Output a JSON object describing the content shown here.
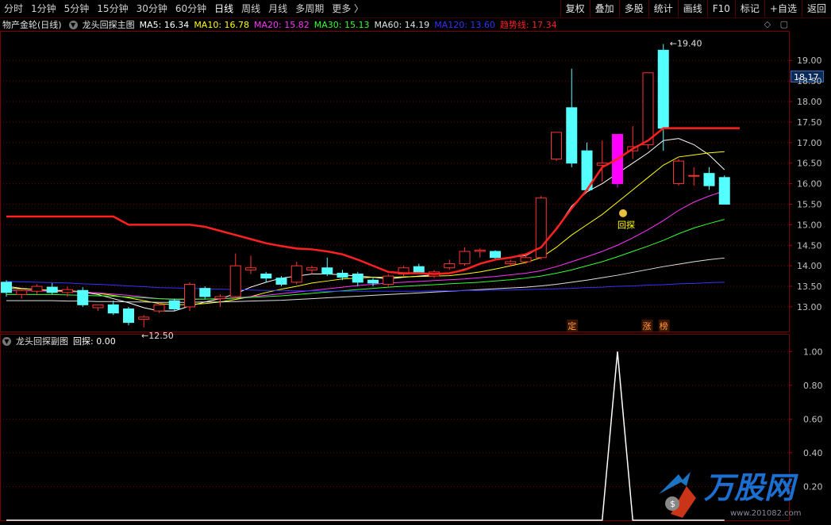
{
  "toolbar": {
    "periods": [
      {
        "label": "分时",
        "active": false
      },
      {
        "label": "1分钟",
        "active": false
      },
      {
        "label": "5分钟",
        "active": false
      },
      {
        "label": "15分钟",
        "active": false
      },
      {
        "label": "30分钟",
        "active": false
      },
      {
        "label": "60分钟",
        "active": false
      },
      {
        "label": "日线",
        "active": true
      },
      {
        "label": "周线",
        "active": false
      },
      {
        "label": "月线",
        "active": false
      },
      {
        "label": "多周期",
        "active": false
      },
      {
        "label": "更多 〉",
        "active": false
      }
    ],
    "buttons": [
      "复权",
      "叠加",
      "多股",
      "统计",
      "画线",
      "F10",
      "标记",
      "+自选",
      "返回"
    ]
  },
  "main_chart": {
    "stock_name": "物产金轮(日线)",
    "indicator_name": "龙头回探主图",
    "ma_labels": [
      {
        "text": "MA5: 16.34",
        "color": "#ffffff"
      },
      {
        "text": "MA10: 16.78",
        "color": "#ffff00"
      },
      {
        "text": "MA20: 15.82",
        "color": "#ff33ff"
      },
      {
        "text": "MA30: 15.13",
        "color": "#33ff33"
      },
      {
        "text": "MA60: 14.19",
        "color": "#e0e0e0"
      },
      {
        "text": "MA120: 13.60",
        "color": "#3333ff"
      },
      {
        "text": "趋势线: 17.34",
        "color": "#ff2020"
      }
    ],
    "price_axis_ticks": [
      "19.00",
      "18.50",
      "18.00",
      "17.50",
      "17.00",
      "16.50",
      "16.00",
      "15.50",
      "15.00",
      "14.50",
      "14.00",
      "13.50",
      "13.00"
    ],
    "current_price": "18.17",
    "high_annotation": "19.40",
    "low_annotation": "12.50",
    "signal_label": "回探",
    "signal_icon": "money-bag-icon",
    "event_tags": [
      "定",
      "涨",
      "榜"
    ]
  },
  "sub_chart": {
    "indicator_name": "龙头回探副图",
    "value_label": "回探: 0.00",
    "axis_ticks": [
      "1.00",
      "0.80",
      "0.60",
      "0.40",
      "0.20"
    ]
  },
  "watermark": {
    "brand": "万股网",
    "url": "www.201082.com"
  },
  "colors": {
    "up_candle": "#ff3232",
    "down_candle": "#54ffff",
    "limit_up_candle": "#ff00ff",
    "trend_line": "#ff2020",
    "grid": "#7a0000"
  },
  "chart_data": {
    "type": "candlestick",
    "price_range": [
      12.4,
      19.7
    ],
    "candles": [
      {
        "o": 13.6,
        "h": 13.65,
        "l": 13.25,
        "c": 13.35
      },
      {
        "o": 13.3,
        "h": 13.45,
        "l": 13.2,
        "c": 13.4
      },
      {
        "o": 13.38,
        "h": 13.55,
        "l": 13.3,
        "c": 13.5
      },
      {
        "o": 13.48,
        "h": 13.58,
        "l": 13.3,
        "c": 13.35
      },
      {
        "o": 13.35,
        "h": 13.5,
        "l": 13.25,
        "c": 13.42
      },
      {
        "o": 13.4,
        "h": 13.48,
        "l": 13.0,
        "c": 13.05
      },
      {
        "o": 12.98,
        "h": 13.05,
        "l": 12.9,
        "c": 13.05
      },
      {
        "o": 13.05,
        "h": 13.15,
        "l": 12.8,
        "c": 12.85
      },
      {
        "o": 12.95,
        "h": 13.0,
        "l": 12.55,
        "c": 12.62
      },
      {
        "o": 12.7,
        "h": 12.8,
        "l": 12.5,
        "c": 12.75
      },
      {
        "o": 12.9,
        "h": 13.1,
        "l": 12.85,
        "c": 13.05
      },
      {
        "o": 13.15,
        "h": 13.2,
        "l": 12.9,
        "c": 12.95
      },
      {
        "o": 13.0,
        "h": 13.6,
        "l": 12.9,
        "c": 13.55
      },
      {
        "o": 13.45,
        "h": 13.5,
        "l": 13.2,
        "c": 13.25
      },
      {
        "o": 13.2,
        "h": 13.3,
        "l": 13.0,
        "c": 13.25
      },
      {
        "o": 13.25,
        "h": 14.3,
        "l": 13.2,
        "c": 14.0
      },
      {
        "o": 13.9,
        "h": 14.25,
        "l": 13.8,
        "c": 13.95
      },
      {
        "o": 13.8,
        "h": 13.85,
        "l": 13.6,
        "c": 13.7
      },
      {
        "o": 13.7,
        "h": 13.75,
        "l": 13.5,
        "c": 13.55
      },
      {
        "o": 13.6,
        "h": 14.1,
        "l": 13.55,
        "c": 14.0
      },
      {
        "o": 13.9,
        "h": 14.0,
        "l": 13.8,
        "c": 13.95
      },
      {
        "o": 13.95,
        "h": 14.2,
        "l": 13.75,
        "c": 13.8
      },
      {
        "o": 13.82,
        "h": 13.9,
        "l": 13.65,
        "c": 13.72
      },
      {
        "o": 13.8,
        "h": 13.85,
        "l": 13.5,
        "c": 13.6
      },
      {
        "o": 13.65,
        "h": 13.7,
        "l": 13.5,
        "c": 13.58
      },
      {
        "o": 13.55,
        "h": 13.8,
        "l": 13.5,
        "c": 13.75
      },
      {
        "o": 13.8,
        "h": 14.0,
        "l": 13.75,
        "c": 13.95
      },
      {
        "o": 13.98,
        "h": 14.05,
        "l": 13.8,
        "c": 13.85
      },
      {
        "o": 13.75,
        "h": 13.9,
        "l": 13.7,
        "c": 13.85
      },
      {
        "o": 13.95,
        "h": 14.15,
        "l": 13.9,
        "c": 14.05
      },
      {
        "o": 14.05,
        "h": 14.45,
        "l": 14.0,
        "c": 14.35
      },
      {
        "o": 14.35,
        "h": 14.42,
        "l": 14.2,
        "c": 14.38
      },
      {
        "o": 14.35,
        "h": 14.38,
        "l": 14.15,
        "c": 14.2
      },
      {
        "o": 14.05,
        "h": 14.15,
        "l": 13.98,
        "c": 14.1
      },
      {
        "o": 14.1,
        "h": 14.3,
        "l": 14.05,
        "c": 14.2
      },
      {
        "o": 14.2,
        "h": 15.7,
        "l": 14.15,
        "c": 15.65
      },
      {
        "o": 16.6,
        "h": 17.25,
        "l": 16.55,
        "c": 17.25
      },
      {
        "o": 17.85,
        "h": 18.8,
        "l": 16.4,
        "c": 16.5
      },
      {
        "o": 16.8,
        "h": 17.0,
        "l": 15.8,
        "c": 15.85
      },
      {
        "o": 16.45,
        "h": 17.05,
        "l": 16.05,
        "c": 16.5
      },
      {
        "o": 16.0,
        "h": 17.2,
        "l": 15.9,
        "c": 17.2
      },
      {
        "o": 16.8,
        "h": 17.4,
        "l": 16.6,
        "c": 16.9
      },
      {
        "o": 16.95,
        "h": 18.7,
        "l": 16.85,
        "c": 18.7
      },
      {
        "o": 19.25,
        "h": 19.4,
        "l": 16.8,
        "c": 17.35
      },
      {
        "o": 16.0,
        "h": 16.6,
        "l": 15.95,
        "c": 16.55
      },
      {
        "o": 16.2,
        "h": 16.4,
        "l": 15.95,
        "c": 16.2
      },
      {
        "o": 16.25,
        "h": 16.4,
        "l": 15.85,
        "c": 15.95
      },
      {
        "o": 16.15,
        "h": 16.2,
        "l": 15.5,
        "c": 15.5
      }
    ],
    "limit_up_index": 40,
    "series": [
      {
        "name": "趋势线",
        "color": "#ff2020",
        "values": [
          15.2,
          15.2,
          15.2,
          15.2,
          15.2,
          15.2,
          15.2,
          15.2,
          15.0,
          15.0,
          15.0,
          15.0,
          15.0,
          14.95,
          14.85,
          14.75,
          14.65,
          14.55,
          14.48,
          14.42,
          14.4,
          14.35,
          14.28,
          14.15,
          14.0,
          13.85,
          13.82,
          13.82,
          13.8,
          13.82,
          13.9,
          14.05,
          14.15,
          14.2,
          14.28,
          14.45,
          14.9,
          15.4,
          15.85,
          16.4,
          16.6,
          16.85,
          17.05,
          17.35,
          17.35,
          17.35,
          17.35,
          17.35,
          17.35
        ]
      },
      {
        "name": "MA5",
        "color": "#ffffff",
        "values": [
          13.5,
          13.45,
          13.42,
          13.4,
          13.4,
          13.36,
          13.3,
          13.2,
          13.1,
          12.98,
          12.9,
          12.9,
          13.02,
          13.12,
          13.2,
          13.32,
          13.48,
          13.6,
          13.7,
          13.75,
          13.8,
          13.8,
          13.78,
          13.75,
          13.72,
          13.68,
          13.72,
          13.75,
          13.78,
          13.82,
          13.92,
          14.05,
          14.15,
          14.2,
          14.25,
          14.45,
          14.9,
          15.45,
          15.8,
          16.0,
          16.25,
          16.5,
          16.75,
          17.05,
          17.1,
          16.95,
          16.7,
          16.34
        ]
      },
      {
        "name": "MA10",
        "color": "#ffff00",
        "values": [
          13.45,
          13.44,
          13.42,
          13.4,
          13.39,
          13.37,
          13.33,
          13.28,
          13.22,
          13.15,
          13.08,
          13.05,
          13.06,
          13.08,
          13.12,
          13.18,
          13.25,
          13.35,
          13.43,
          13.5,
          13.58,
          13.63,
          13.68,
          13.7,
          13.72,
          13.72,
          13.73,
          13.74,
          13.75,
          13.76,
          13.8,
          13.85,
          13.92,
          14.0,
          14.08,
          14.2,
          14.45,
          14.75,
          15.0,
          15.25,
          15.55,
          15.85,
          16.15,
          16.45,
          16.65,
          16.7,
          16.75,
          16.78
        ]
      },
      {
        "name": "MA20",
        "color": "#ff33ff",
        "values": [
          13.4,
          13.4,
          13.39,
          13.38,
          13.37,
          13.36,
          13.34,
          13.31,
          13.28,
          13.24,
          13.2,
          13.18,
          13.18,
          13.19,
          13.2,
          13.22,
          13.25,
          13.28,
          13.32,
          13.36,
          13.4,
          13.44,
          13.48,
          13.52,
          13.55,
          13.58,
          13.6,
          13.62,
          13.64,
          13.66,
          13.68,
          13.71,
          13.74,
          13.78,
          13.82,
          13.88,
          13.98,
          14.1,
          14.22,
          14.35,
          14.5,
          14.68,
          14.88,
          15.1,
          15.35,
          15.55,
          15.7,
          15.82
        ]
      },
      {
        "name": "MA30",
        "color": "#33ff33",
        "values": [
          13.3,
          13.3,
          13.3,
          13.3,
          13.29,
          13.28,
          13.27,
          13.26,
          13.24,
          13.22,
          13.2,
          13.19,
          13.19,
          13.19,
          13.2,
          13.21,
          13.23,
          13.25,
          13.27,
          13.3,
          13.33,
          13.36,
          13.39,
          13.42,
          13.45,
          13.48,
          13.5,
          13.52,
          13.54,
          13.56,
          13.58,
          13.6,
          13.63,
          13.66,
          13.7,
          13.75,
          13.82,
          13.9,
          14.0,
          14.1,
          14.22,
          14.35,
          14.48,
          14.62,
          14.78,
          14.92,
          15.03,
          15.13
        ]
      },
      {
        "name": "MA60",
        "color": "#e0e0e0",
        "values": [
          13.15,
          13.15,
          13.15,
          13.15,
          13.14,
          13.14,
          13.13,
          13.13,
          13.12,
          13.12,
          13.11,
          13.11,
          13.11,
          13.12,
          13.12,
          13.13,
          13.14,
          13.15,
          13.16,
          13.18,
          13.2,
          13.22,
          13.24,
          13.26,
          13.28,
          13.3,
          13.32,
          13.34,
          13.36,
          13.38,
          13.4,
          13.42,
          13.44,
          13.46,
          13.48,
          13.51,
          13.55,
          13.6,
          13.65,
          13.71,
          13.77,
          13.84,
          13.91,
          13.98,
          14.04,
          14.1,
          14.15,
          14.19
        ]
      },
      {
        "name": "MA120",
        "color": "#3333ff",
        "values": [
          13.62,
          13.61,
          13.6,
          13.59,
          13.58,
          13.56,
          13.55,
          13.53,
          13.51,
          13.49,
          13.47,
          13.46,
          13.45,
          13.44,
          13.43,
          13.42,
          13.41,
          13.4,
          13.4,
          13.39,
          13.39,
          13.38,
          13.38,
          13.38,
          13.38,
          13.38,
          13.38,
          13.38,
          13.39,
          13.39,
          13.4,
          13.4,
          13.41,
          13.41,
          13.42,
          13.43,
          13.44,
          13.45,
          13.47,
          13.48,
          13.5,
          13.51,
          13.53,
          13.54,
          13.56,
          13.57,
          13.59,
          13.6
        ]
      }
    ],
    "sub_series": {
      "name": "回探",
      "range": [
        0,
        1.1
      ],
      "values": [
        0,
        0,
        0,
        0,
        0,
        0,
        0,
        0,
        0,
        0,
        0,
        0,
        0,
        0,
        0,
        0,
        0,
        0,
        0,
        0,
        0,
        0,
        0,
        0,
        0,
        0,
        0,
        0,
        0,
        0,
        0,
        0,
        0,
        0,
        0,
        0,
        0,
        0,
        0,
        0,
        1,
        0,
        0,
        0,
        0,
        0,
        0,
        0
      ]
    }
  }
}
